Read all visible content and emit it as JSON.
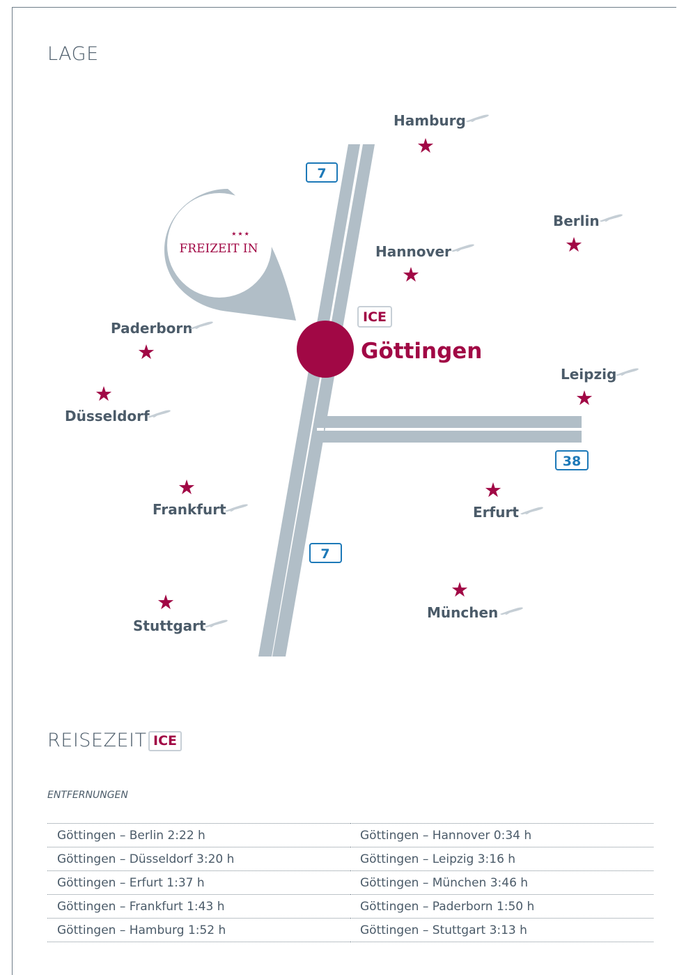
{
  "section_lage": "LAGE",
  "section_reisezeit": "REISEZEIT",
  "ice_badge": "ICE",
  "logo_text": "FREIZEIT IN",
  "center_city": "Göttingen",
  "highway_a7": "7",
  "highway_a38": "38",
  "cities": {
    "hamburg": "Hamburg",
    "berlin": "Berlin",
    "hannover": "Hannover",
    "paderborn": "Paderborn",
    "duesseldorf": "Düsseldorf",
    "leipzig": "Leipzig",
    "frankfurt": "Frankfurt",
    "erfurt": "Erfurt",
    "stuttgart": "Stuttgart",
    "muenchen": "München"
  },
  "entfernungen_label": "ENTFERNUNGEN",
  "distances": [
    [
      "Göttingen – Berlin 2:22 h",
      "Göttingen – Hannover 0:34 h"
    ],
    [
      "Göttingen – Düsseldorf 3:20 h",
      "Göttingen – Leipzig 3:16 h"
    ],
    [
      "Göttingen – Erfurt 1:37 h",
      "Göttingen – München 3:46 h"
    ],
    [
      "Göttingen – Frankfurt 1:43 h",
      "Göttingen – Paderborn 1:50 h"
    ],
    [
      "Göttingen – Hamburg 1:52 h",
      "Göttingen – Stuttgart 3:13 h"
    ]
  ],
  "colors": {
    "accent": "#a10845",
    "road": "#b1bec7",
    "highway_blue": "#1d79b8",
    "text": "#4b5b69"
  },
  "icons": {
    "city_marker": "star-icon",
    "airport": "plane-icon"
  }
}
